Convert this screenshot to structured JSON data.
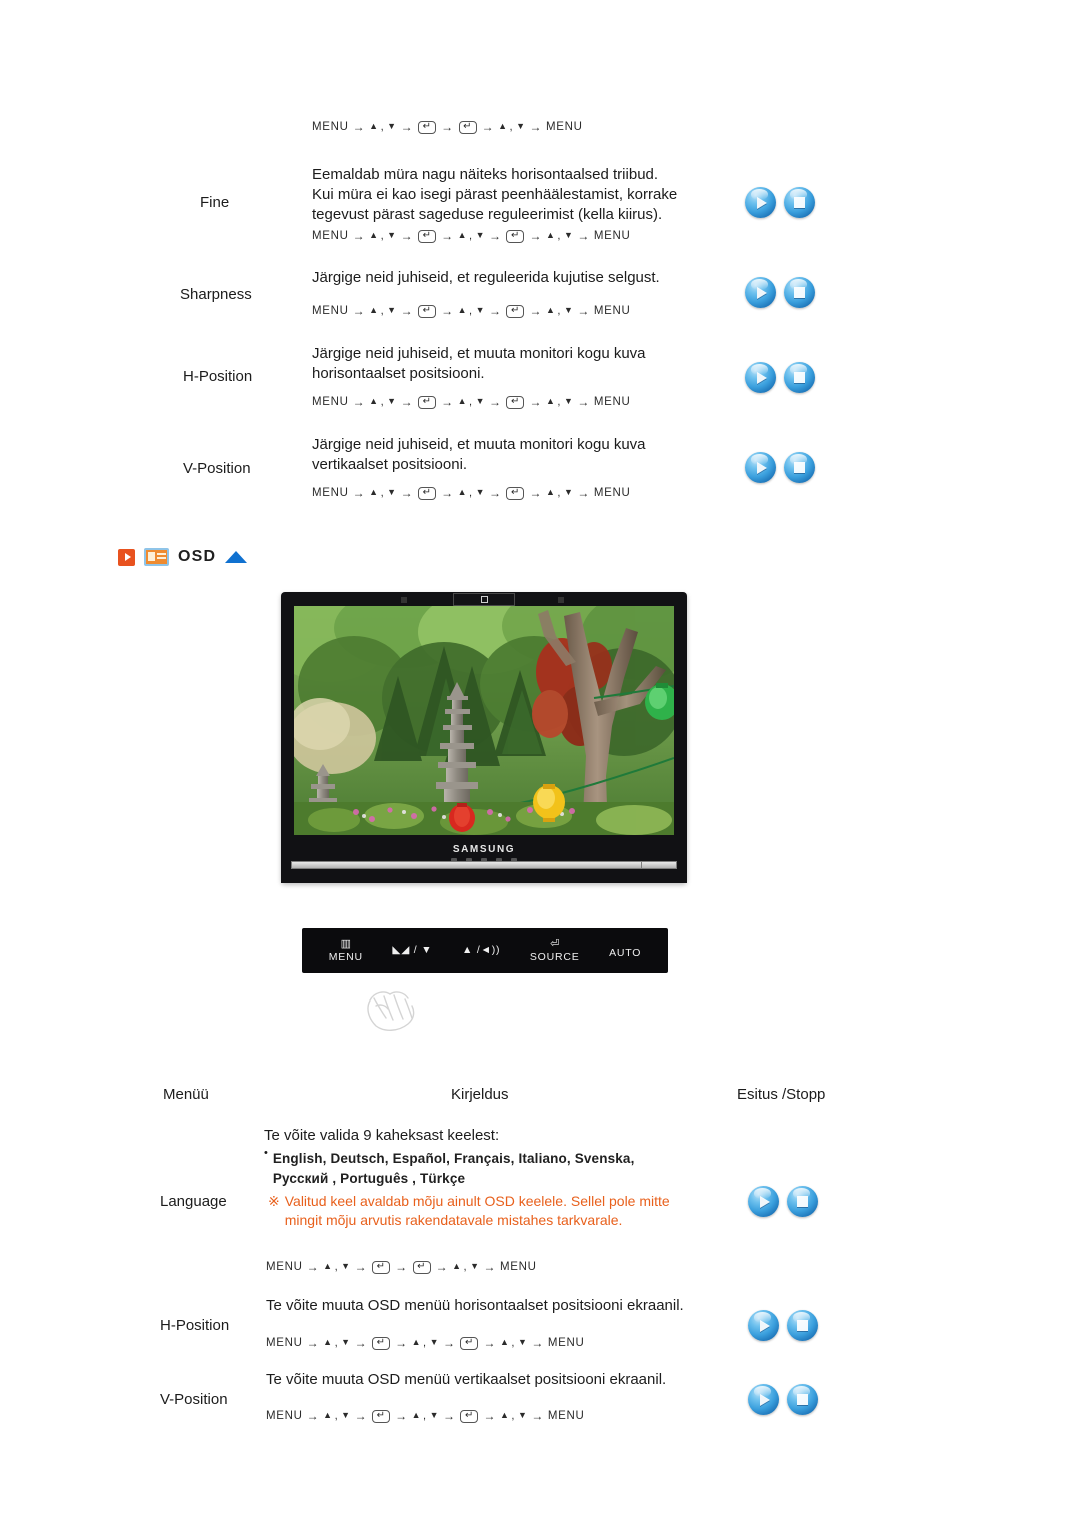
{
  "nav_sequences": {
    "short": [
      "MENU",
      "→",
      "▲",
      ",",
      "▼",
      "→",
      "⏎",
      "→",
      "⏎",
      "→",
      "▲",
      ",",
      "▼",
      "→",
      "MENU"
    ],
    "long": [
      "MENU",
      "→",
      "▲",
      ",",
      "▼",
      "→",
      "⏎",
      "→",
      "▲",
      ",",
      "▼",
      "→",
      "⏎",
      "→",
      "▲",
      ",",
      "▼",
      "→",
      "MENU"
    ]
  },
  "top_section": {
    "lead_nav_label": "MENU → ▲ , ▼ → ⏎ → ⏎ → ▲ , ▼ → MENU",
    "rows": [
      {
        "menu": "Fine",
        "description": "Eemaldab müra nagu näiteks horisontaalsed triibud.\nKui müra ei kao isegi pärast peenhäälestamist, korrake\ntegevust pärast sageduse reguleerimist (kella kiirus).",
        "nav": "long"
      },
      {
        "menu": "Sharpness",
        "description": "Järgige neid juhiseid, et reguleerida kujutise selgust.",
        "nav": "long"
      },
      {
        "menu": "H-Position",
        "description": "Järgige neid juhiseid, et muuta monitori kogu kuva\nhorisontaalset positsiooni.",
        "nav": "long"
      },
      {
        "menu": "V-Position",
        "description": "Järgige neid juhiseid, et muuta monitori kogu kuva\nvertikaalset positsiooni.",
        "nav": "long"
      }
    ]
  },
  "osd_heading": {
    "title": "OSD",
    "play_icon": "play-square-icon",
    "monitor_icon": "monitor-icon",
    "collapse_icon": "triangle-up-icon",
    "accent_orange": "#e8521f",
    "accent_blue": "#1071d0"
  },
  "monitor_illustration": {
    "brand": "SAMSUNG",
    "alt": "Samsung monitor displaying a Korean garden with a stone pagoda, trees and paper lanterns"
  },
  "control_bar": {
    "buttons": [
      {
        "glyph": "▥",
        "label": "MENU",
        "name": "menu-button"
      },
      {
        "glyph": "◣◢ / ▼",
        "label": "",
        "name": "brightness-down-button"
      },
      {
        "glyph": "▲ /◄))",
        "label": "",
        "name": "volume-up-button"
      },
      {
        "glyph": "⏎",
        "label": "SOURCE",
        "name": "source-button"
      },
      {
        "glyph": "",
        "label": "AUTO",
        "name": "auto-button"
      }
    ]
  },
  "hand_graphic": "hand-illustration",
  "bottom_table": {
    "headers": {
      "menu": "Menüü",
      "description": "Kirjeldus",
      "playstop": "Esitus /Stopp"
    },
    "rows": [
      {
        "menu": "Language",
        "intro": "Te võite valida 9 kaheksast keelest:",
        "languages_line1": "English, Deutsch, Español, Français,  Italiano, Svenska,",
        "languages_line2": "Русский , Português , Türkçe",
        "note_mark": "※",
        "note": "Valitud keel avaldab mõju ainult OSD keelele. Sellel pole mitte\nmingit mõju arvutis rakendatavale mistahes tarkvarale.",
        "nav": "short"
      },
      {
        "menu": "H-Position",
        "description": "Te võite muuta OSD menüü horisontaalset positsiooni ekraanil.",
        "nav": "long"
      },
      {
        "menu": "V-Position",
        "description": "Te võite muuta OSD menüü vertikaalset positsiooni ekraanil.",
        "nav": "long"
      }
    ]
  },
  "buttons": {
    "play_label": "play-button",
    "stop_label": "stop-button"
  }
}
